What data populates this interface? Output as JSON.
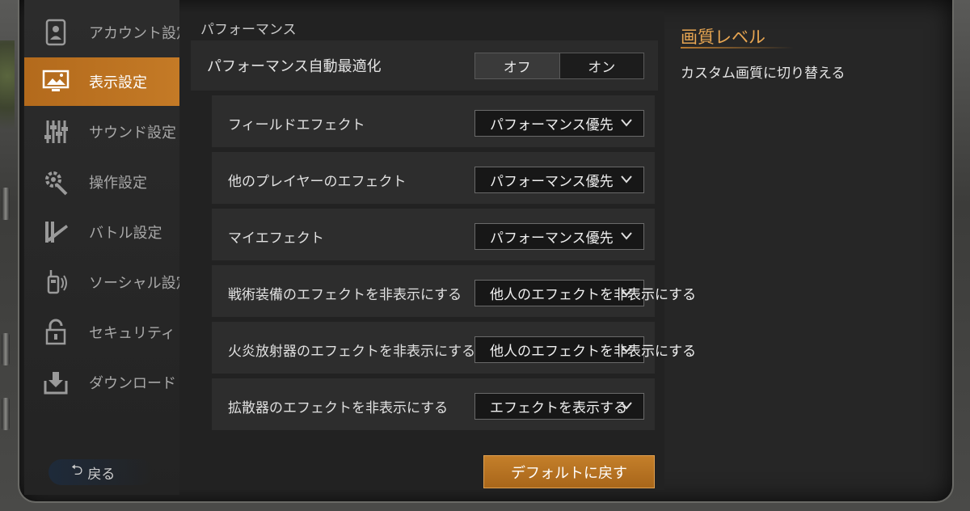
{
  "sidebar": {
    "items": [
      {
        "label": "アカウント設定",
        "icon": "account-icon"
      },
      {
        "label": "表示設定",
        "icon": "display-icon"
      },
      {
        "label": "サウンド設定",
        "icon": "sound-sliders-icon"
      },
      {
        "label": "操作設定",
        "icon": "gear-wrench-icon"
      },
      {
        "label": "バトル設定",
        "icon": "weapons-icon"
      },
      {
        "label": "ソーシャル設定",
        "icon": "walkie-talkie-icon"
      },
      {
        "label": "セキュリティ",
        "icon": "lock-icon"
      },
      {
        "label": "ダウンロード",
        "icon": "download-icon"
      }
    ],
    "active": "表示設定",
    "back_label": "戻る"
  },
  "main": {
    "section_title": "パフォーマンス",
    "auto_optimize": {
      "label": "パフォーマンス自動最適化",
      "off_label": "オフ",
      "on_label": "オン",
      "selected": "オフ"
    },
    "settings": [
      {
        "label": "フィールドエフェクト",
        "value": "パフォーマンス優先"
      },
      {
        "label": "他のプレイヤーのエフェクト",
        "value": "パフォーマンス優先"
      },
      {
        "label": "マイエフェクト",
        "value": "パフォーマンス優先"
      },
      {
        "label": "戦術装備のエフェクトを非表示にする",
        "value": "他人のエフェクトを非表示にする"
      },
      {
        "label": "火炎放射器のエフェクトを非表示にする",
        "value": "他人のエフェクトを非表示にする"
      },
      {
        "label": "拡散器のエフェクトを非表示にする",
        "value": "エフェクトを表示する"
      }
    ],
    "default_button": "デフォルトに戻す"
  },
  "info": {
    "title": "画質レベル",
    "text": "カスタム画質に切り替える"
  },
  "colors": {
    "accent": "#c47a26",
    "info_title": "#e8a652"
  }
}
